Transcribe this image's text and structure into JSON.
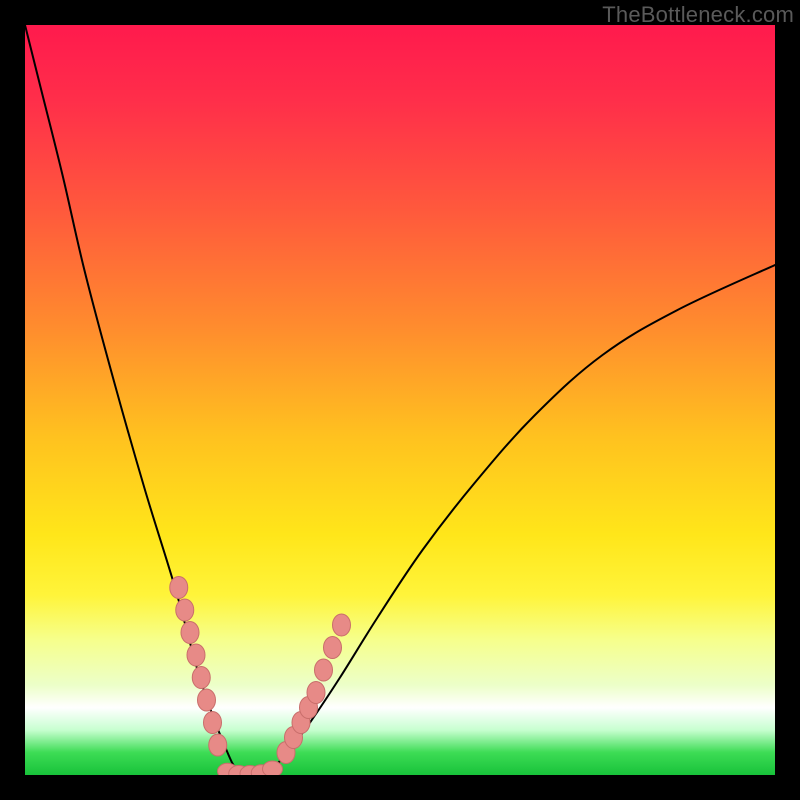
{
  "watermark": "TheBottleneck.com",
  "chart_data": {
    "type": "line",
    "title": "",
    "xlabel": "",
    "ylabel": "",
    "xlim": [
      0,
      100
    ],
    "ylim": [
      0,
      100
    ],
    "grid": false,
    "axis_ticks": [],
    "background_gradient": {
      "stops": [
        {
          "pos": 0,
          "color": "#ff1a4d"
        },
        {
          "pos": 25,
          "color": "#ff5a3c"
        },
        {
          "pos": 55,
          "color": "#ffc21f"
        },
        {
          "pos": 76,
          "color": "#fff43a"
        },
        {
          "pos": 91,
          "color": "#ffffff"
        },
        {
          "pos": 100,
          "color": "#18c23a"
        }
      ]
    },
    "series": [
      {
        "name": "bottleneck-curve",
        "color": "#000000",
        "x": [
          0,
          2,
          5,
          8,
          12,
          16,
          20,
          23,
          25,
          27,
          28,
          29,
          30,
          31,
          33,
          35,
          38,
          42,
          47,
          53,
          60,
          68,
          77,
          87,
          100
        ],
        "y": [
          100,
          92,
          80,
          67,
          52,
          38,
          25,
          14,
          8,
          3,
          1,
          0,
          0,
          0,
          1,
          3,
          7,
          13,
          21,
          30,
          39,
          48,
          56,
          62,
          68
        ]
      }
    ],
    "beads": {
      "color": "#e78a87",
      "left_branch_x": [
        20.5,
        21.3,
        22.0,
        22.8,
        23.5,
        24.2,
        25.0,
        25.7
      ],
      "left_branch_y": [
        25,
        22,
        19,
        16,
        13,
        10,
        7,
        4
      ],
      "bottom_x": [
        27.0,
        28.5,
        30.0,
        31.5,
        33.0
      ],
      "bottom_y": [
        0.5,
        0.2,
        0.2,
        0.3,
        0.8
      ],
      "right_branch_x": [
        34.8,
        35.8,
        36.8,
        37.8,
        38.8,
        39.8,
        41.0,
        42.2
      ],
      "right_branch_y": [
        3,
        5,
        7,
        9,
        11,
        14,
        17,
        20
      ]
    }
  }
}
